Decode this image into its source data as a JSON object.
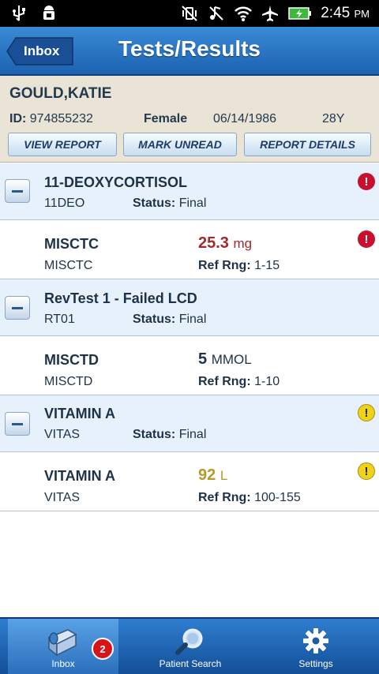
{
  "status_bar": {
    "time": "2:45",
    "ampm": "PM",
    "icons": [
      "usb-icon",
      "android-debug-icon",
      "vibrate-off-icon",
      "mute-icon",
      "wifi-icon",
      "airplane-icon",
      "battery-charging-icon"
    ]
  },
  "header": {
    "back_label": "Inbox",
    "title": "Tests/Results"
  },
  "patient": {
    "name": "GOULD,KATIE",
    "id_label": "ID:",
    "id": "974855232",
    "sex": "Female",
    "dob": "06/14/1986",
    "age": "28Y",
    "buttons": {
      "view_report": "VIEW REPORT",
      "mark_unread": "MARK UNREAD",
      "report_details": "REPORT DETAILS"
    }
  },
  "results": [
    {
      "group_name": "11-DEOXYCORTISOL",
      "group_code": "11DEO",
      "status_label": "Status:",
      "status": "Final",
      "group_flag": "critical",
      "item_name": "MISCTC",
      "item_code": "MISCTC",
      "value": "25.3",
      "unit": "mg",
      "value_color": "#a22a2a",
      "ref_label": "Ref Rng:",
      "ref_range": "1-15",
      "item_flag": "critical"
    },
    {
      "group_name": "RevTest 1 - Failed LCD",
      "group_code": "RT01",
      "status_label": "Status:",
      "status": "Final",
      "group_flag": "",
      "item_name": "MISCTD",
      "item_code": "MISCTD",
      "value": "5",
      "unit": "MMOL",
      "value_color": "#1e3247",
      "ref_label": "Ref Rng:",
      "ref_range": "1-10",
      "item_flag": ""
    },
    {
      "group_name": "VITAMIN A",
      "group_code": "VITAS",
      "status_label": "Status:",
      "status": "Final",
      "group_flag": "warning",
      "item_name": "VITAMIN A",
      "item_code": "VITAS",
      "value": "92",
      "unit": "L",
      "value_color": "#b59a2a",
      "ref_label": "Ref Rng:",
      "ref_range": "100-155",
      "item_flag": "warning"
    }
  ],
  "tabs": {
    "inbox": "Inbox",
    "inbox_badge": "2",
    "patient_search": "Patient Search",
    "settings": "Settings"
  },
  "flag_glyph": "!"
}
